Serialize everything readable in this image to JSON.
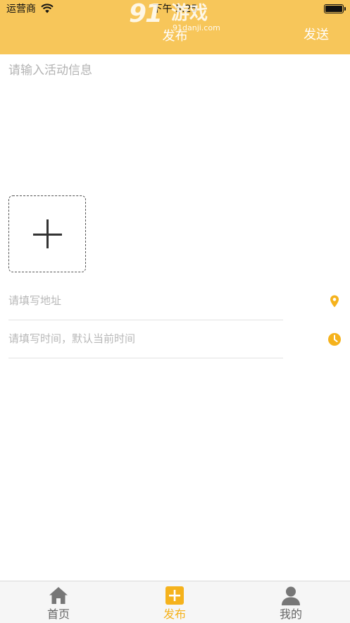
{
  "status_bar": {
    "carrier": "运营商",
    "time": "下午 5:25",
    "wifi_icon": "wifi-icon",
    "battery_icon": "battery-icon"
  },
  "watermark": {
    "logo_number": "91",
    "logo_text": "游戏",
    "url": "91danji.com"
  },
  "nav": {
    "title": "发布",
    "send_label": "发送"
  },
  "form": {
    "activity_placeholder": "请输入活动信息",
    "add_photo_icon": "plus-icon",
    "address_placeholder": "请填写地址",
    "address_icon": "location-pin-icon",
    "time_placeholder": "请填写时间，默认当前时间",
    "time_icon": "clock-icon"
  },
  "tabs": [
    {
      "label": "首页",
      "icon": "home-icon",
      "active": false
    },
    {
      "label": "发布",
      "icon": "add-square-icon",
      "active": true
    },
    {
      "label": "我的",
      "icon": "person-icon",
      "active": false
    }
  ],
  "colors": {
    "header_bg": "#f7c65a",
    "accent": "#f5b21c",
    "tab_inactive": "#666666",
    "placeholder": "#b3b3b3"
  }
}
